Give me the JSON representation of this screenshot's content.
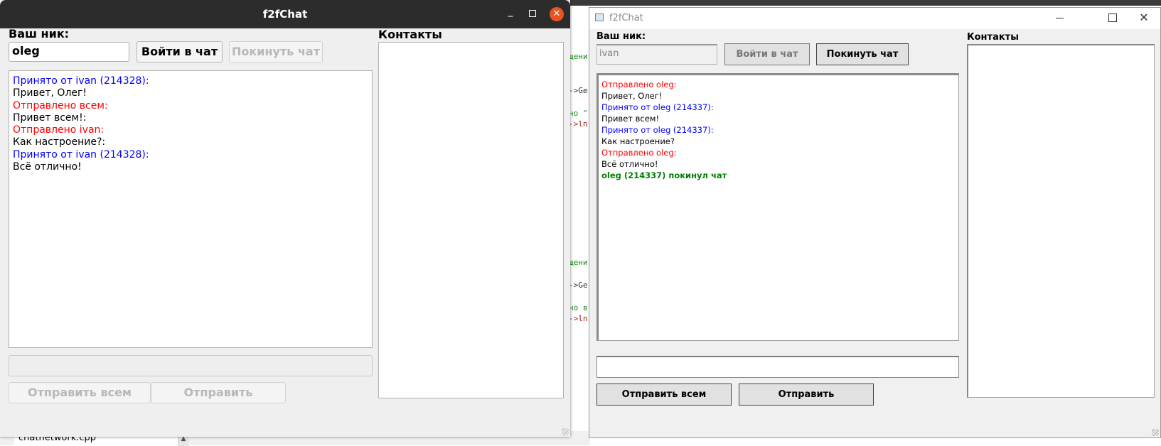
{
  "windows": {
    "linux": {
      "title": "f2fChat",
      "nick_label": "Ваш ник:",
      "nick_value": "oleg",
      "join_button": "Войти в чат",
      "leave_button": "Покинуть чат",
      "contacts_label": "Контакты",
      "send_all_button": "Отправить всем",
      "send_button": "Отправить",
      "messages": [
        {
          "text": "Принято от ivan (214328):",
          "color": "#0000ff"
        },
        {
          "text": "Привет, Олег!",
          "color": "#000000"
        },
        {
          "text": "Отправлено всем:",
          "color": "#ff0000"
        },
        {
          "text": "Привет всем!:",
          "color": "#000000"
        },
        {
          "text": "Отправлено ivan:",
          "color": "#ff0000"
        },
        {
          "text": "Как настроение?:",
          "color": "#000000"
        },
        {
          "text": "Принято от ivan (214328):",
          "color": "#0000ff"
        },
        {
          "text": "Всё отлично!",
          "color": "#000000"
        }
      ]
    },
    "windows": {
      "title": "f2fChat",
      "nick_label": "Ваш ник:",
      "nick_value": "ivan",
      "join_button": "Войти в чат",
      "leave_button": "Покинуть чат",
      "contacts_label": "Контакты",
      "send_all_button": "Отправить всем",
      "send_button": "Отправить",
      "messages": [
        {
          "text": "Отправлено oleg:",
          "color": "#ff0000"
        },
        {
          "text": "Привет, Олег!",
          "color": "#000000"
        },
        {
          "text": "Принято от oleg (214337):",
          "color": "#0000ff"
        },
        {
          "text": "Привет всем!",
          "color": "#000000"
        },
        {
          "text": "Принято от oleg (214337):",
          "color": "#0000ff"
        },
        {
          "text": "Как настроение?",
          "color": "#000000"
        },
        {
          "text": "Отправлено oleg:",
          "color": "#ff0000"
        },
        {
          "text": "Всё отлично!",
          "color": "#000000"
        },
        {
          "text": "oleg (214337) покинул чат",
          "color": "#008000"
        }
      ]
    }
  },
  "background": {
    "file_tab": "chatnetwork.cpp",
    "code_fragments": [
      "щени",
      "->Ge",
      "но \"",
      "->ln",
      "щени",
      "->Ge",
      "но в",
      "->ln"
    ]
  }
}
